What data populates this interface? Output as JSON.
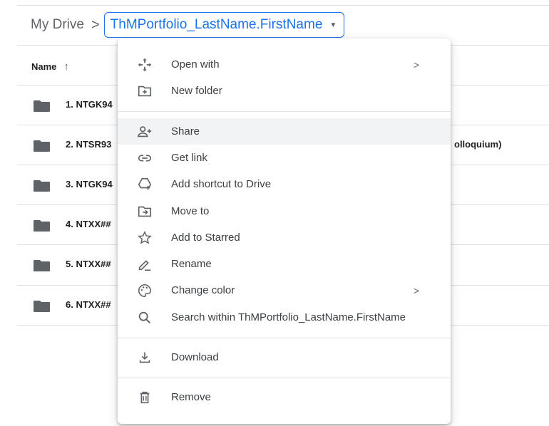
{
  "breadcrumb": {
    "root": "My Drive",
    "separator": ">",
    "current": "ThMPortfolio_LastName.FirstName"
  },
  "list": {
    "header": "Name",
    "rows": [
      {
        "name": "1. NTGK94",
        "extra": ""
      },
      {
        "name": "2. NTSR93",
        "extra": "olloquium)"
      },
      {
        "name": "3. NTGK94",
        "extra": ""
      },
      {
        "name": "4. NTXX##",
        "extra": ""
      },
      {
        "name": "5. NTXX##",
        "extra": ""
      },
      {
        "name": "6. NTXX##",
        "extra": ""
      }
    ]
  },
  "menu": {
    "items": [
      {
        "label": "Open with",
        "icon": "move-cross-icon",
        "submenu": true
      },
      {
        "label": "New folder",
        "icon": "new-folder-icon"
      },
      {
        "label": "Share",
        "icon": "share-person-icon",
        "hovered": true
      },
      {
        "label": "Get link",
        "icon": "link-icon"
      },
      {
        "label": "Add shortcut to Drive",
        "icon": "drive-shortcut-icon"
      },
      {
        "label": "Move to",
        "icon": "move-to-folder-icon"
      },
      {
        "label": "Add to Starred",
        "icon": "star-icon"
      },
      {
        "label": "Rename",
        "icon": "pencil-icon"
      },
      {
        "label": "Change color",
        "icon": "palette-icon",
        "submenu": true
      },
      {
        "label": "Search within ThMPortfolio_LastName.FirstName",
        "icon": "search-icon"
      },
      {
        "label": "Download",
        "icon": "download-icon"
      },
      {
        "label": "Remove",
        "icon": "trash-icon"
      }
    ],
    "submenu_glyph": ">"
  },
  "colors": {
    "accent": "#1a73e8",
    "hover": "#f1f3f4",
    "icon": "#5f6368",
    "folder": "#5f6368"
  }
}
